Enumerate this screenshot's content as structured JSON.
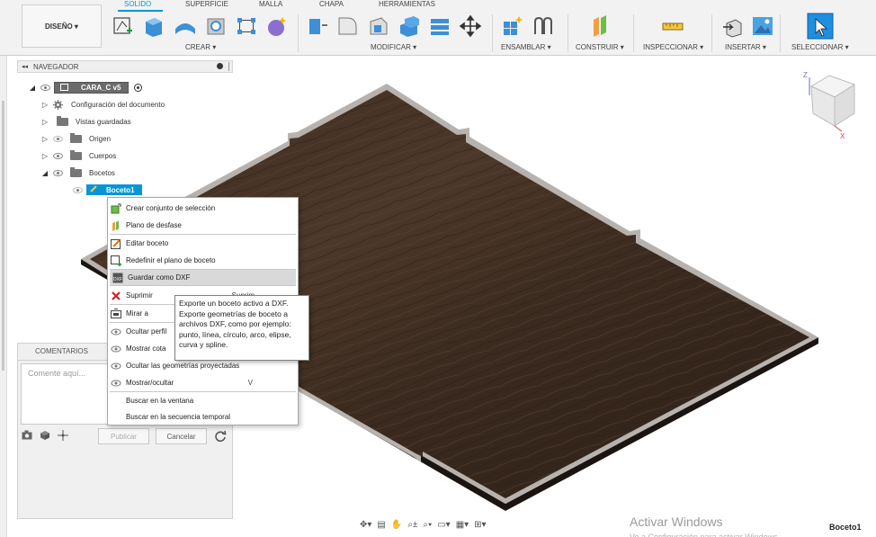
{
  "toolbar": {
    "workspace_button": "DISEÑO ▾",
    "tabs": [
      {
        "label": "SOLIDO",
        "active": true
      },
      {
        "label": "SUPERFICIE",
        "active": false
      },
      {
        "label": "MALLA",
        "active": false
      },
      {
        "label": "CHAPA",
        "active": false
      },
      {
        "label": "HERRAMIENTAS",
        "active": false
      }
    ],
    "groups": [
      {
        "label": "CREAR ▾"
      },
      {
        "label": "MODIFICAR ▾"
      },
      {
        "label": "ENSAMBLAR ▾"
      },
      {
        "label": "CONSTRUIR ▾"
      },
      {
        "label": "INSPECCIONAR ▾"
      },
      {
        "label": "INSERTAR ▾"
      },
      {
        "label": "SELECCIONAR ▾"
      }
    ],
    "accent_color": "#0696d7"
  },
  "navigator": {
    "header": "NAVEGADOR",
    "root": "CARA_C v5",
    "items": [
      {
        "label": "Configuración del documento"
      },
      {
        "label": "Vistas guardadas"
      },
      {
        "label": "Origen"
      },
      {
        "label": "Cuerpos"
      },
      {
        "label": "Bocetos"
      }
    ],
    "selected_sketch": "Boceto1"
  },
  "context_menu": {
    "items": [
      {
        "label": "Crear conjunto de selección",
        "icon": "selection-set-icon"
      },
      {
        "label": "Plano de desfase",
        "icon": "offset-plane-icon"
      },
      {
        "label": "Editar boceto",
        "icon": "edit-sketch-icon"
      },
      {
        "label": "Redefinir el plano de boceto",
        "icon": "redefine-plane-icon"
      },
      {
        "label": "Guardar como DXF",
        "icon": "dxf-icon",
        "highlighted": true
      },
      {
        "label": "Suprimir",
        "icon": "delete-icon",
        "shortcut": "Suprim"
      },
      {
        "label": "Mirar a",
        "icon": "look-at-icon"
      },
      {
        "label": "Ocultar perfil",
        "icon": "eye-icon"
      },
      {
        "label": "Mostrar cota",
        "icon": "eye-icon"
      },
      {
        "label": "Ocultar las geometrías proyectadas",
        "icon": "eye-icon"
      },
      {
        "label": "Mostrar/ocultar",
        "icon": "eye-icon",
        "shortcut": "V"
      },
      {
        "label": "Buscar en la ventana"
      },
      {
        "label": "Buscar en la secuencia temporal"
      }
    ]
  },
  "tooltip": {
    "lines": [
      "Exporte un boceto activo a DXF.",
      "Exporte geometrías de boceto a",
      "archivos DXF, como por ejemplo:",
      "punto, línea, círculo, arco, elipse,",
      "curva y spline."
    ]
  },
  "comments": {
    "title": "COMENTARIOS",
    "placeholder": "Comente aquí...",
    "publish": "Publicar",
    "cancel": "Cancelar"
  },
  "viewcube": {
    "z_label": "Z",
    "x_label": "X"
  },
  "status": {
    "active_sketch": "Boceto1"
  },
  "watermark": {
    "line1": "Activar Windows",
    "line2": "Ve a Configuración para activar Windows."
  },
  "colors": {
    "wood_dark": "#3a2a1f",
    "wood_mid": "#4e3a2c",
    "edge": "#b7b2ad"
  }
}
